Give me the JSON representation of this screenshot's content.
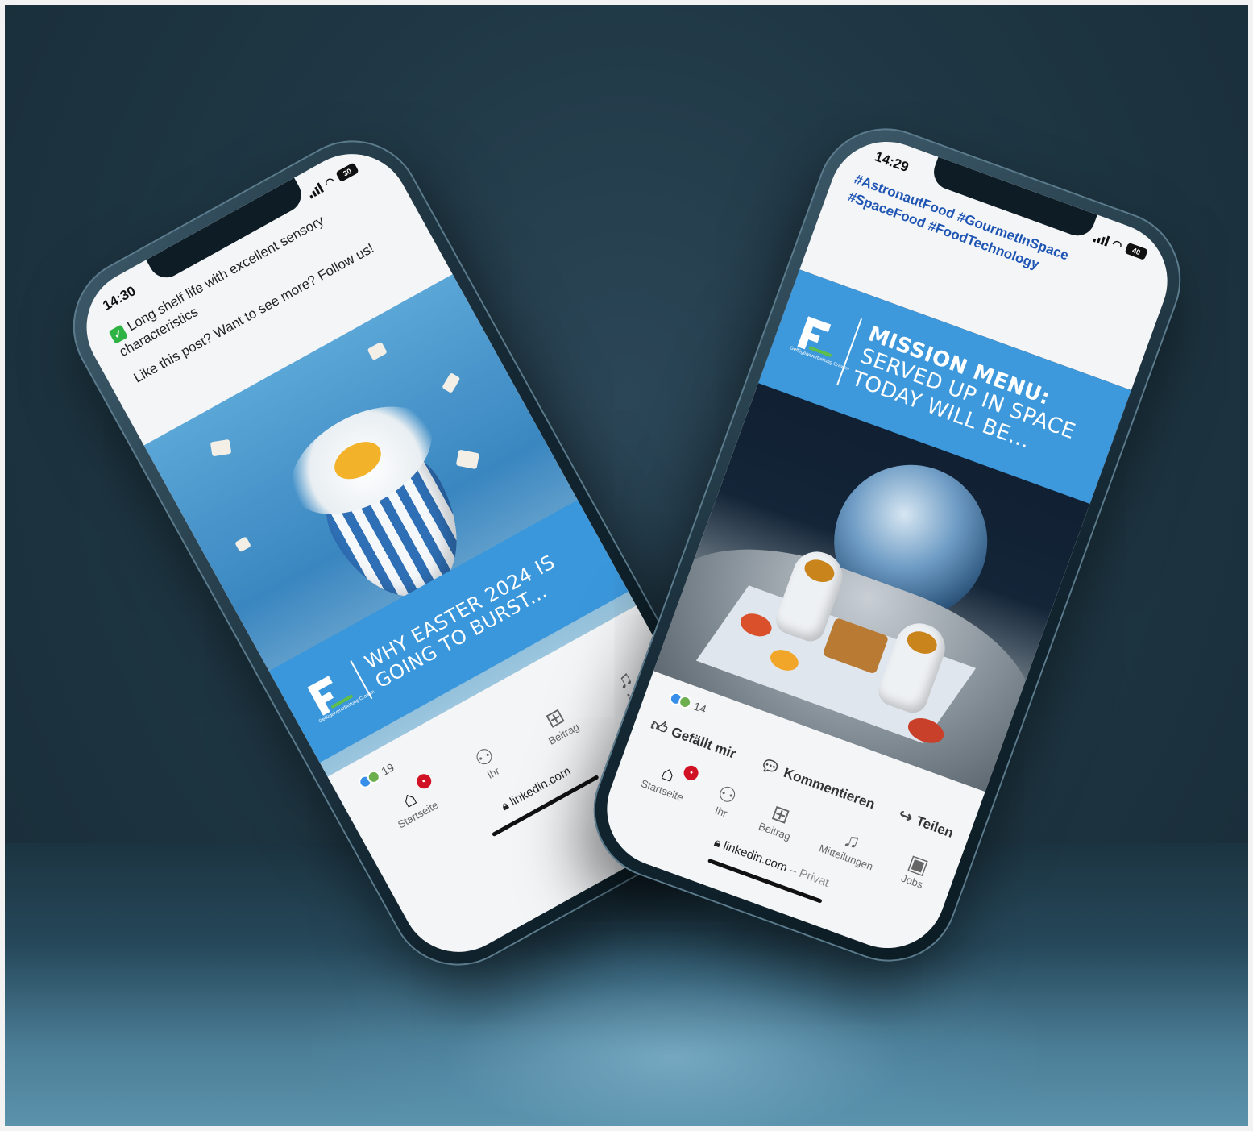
{
  "left_phone": {
    "time": "14:30",
    "battery": "30",
    "post_line1": "Long shelf life with excellent sensory characteristics",
    "check_glyph": "✓",
    "post_line2": "Like this post? Want to see more? Follow us!",
    "banner_text": "WHY EASTER 2024 IS GOING TO BURST...",
    "logo_caption": "Geflügelverarbeitung Crawen",
    "reaction_count": "19",
    "nav": [
      {
        "label": "Startseite",
        "icon": "home-icon",
        "badge": "•"
      },
      {
        "label": "Ihr",
        "icon": "network-icon"
      },
      {
        "label": "Beitrag",
        "icon": "add-post-icon"
      },
      {
        "label": "Mi",
        "icon": "bell-icon"
      }
    ],
    "url": "linkedin.com"
  },
  "right_phone": {
    "time": "14:29",
    "battery": "40",
    "hashtags": "#AstronautFood #GourmetInSpace #SpaceFood #FoodTechnology",
    "banner_title": "MISSION MENU:",
    "banner_sub": "SERVED UP IN SPACE TODAY WILL BE...",
    "logo_caption": "Geflügelverarbeitung Crawen",
    "reaction_count": "14",
    "actions": {
      "like": "Gefällt mir",
      "comment": "Kommentieren",
      "share": "Teilen"
    },
    "nav": [
      {
        "label": "Startseite",
        "icon": "home-icon",
        "badge": "•"
      },
      {
        "label": "Ihr",
        "icon": "network-icon"
      },
      {
        "label": "Beitrag",
        "icon": "add-post-icon"
      },
      {
        "label": "Mitteilungen",
        "icon": "bell-icon"
      },
      {
        "label": "Jobs",
        "icon": "briefcase-icon"
      }
    ],
    "url": "linkedin.com",
    "url_suffix": "– Privat"
  },
  "colors": {
    "background": "#1f3744",
    "banner_blue": "#3b97db",
    "hashtag_blue": "#1e55b3",
    "badge_red": "#d11124",
    "check_green": "#2fb344"
  }
}
